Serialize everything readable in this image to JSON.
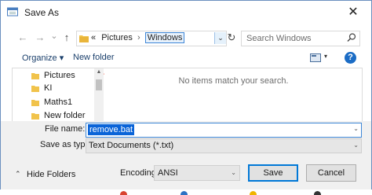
{
  "window": {
    "title": "Save As",
    "close_glyph": "✕"
  },
  "nav": {
    "back_glyph": "←",
    "forward_glyph": "→",
    "history_glyph": "⌄",
    "up_glyph": "↑",
    "address": {
      "overflow": "«",
      "crumbs": [
        "Pictures",
        "Windows"
      ],
      "sep": "›",
      "dropdown_glyph": "⌄"
    },
    "refresh_glyph": "↻",
    "search": {
      "placeholder": "Search Windows"
    }
  },
  "toolbar": {
    "organize_label": "Organize ▾",
    "new_folder_label": "New folder",
    "view_dd": "▾",
    "help_label": "?"
  },
  "navpane": {
    "items": [
      {
        "label": "Pictures",
        "pinned": true,
        "icon": "pictures-folder-icon"
      },
      {
        "label": "KI",
        "icon": "folder-icon"
      },
      {
        "label": "Maths1",
        "icon": "folder-icon"
      },
      {
        "label": "New folder",
        "icon": "folder-icon"
      }
    ],
    "pin_glyph": "📌"
  },
  "filepane": {
    "empty_message": "No items match your search."
  },
  "form": {
    "file_name_label": "File name:",
    "file_name_value": "remove.bat",
    "save_type_label": "Save as type:",
    "save_type_value": "Text Documents (*.txt)",
    "dropdown_glyph": "⌄"
  },
  "footer": {
    "hide_folders_chevron": "⌃",
    "hide_folders_label": "Hide Folders",
    "encoding_label": "Encoding:",
    "encoding_value": "ANSI",
    "save_label": "Save",
    "cancel_label": "Cancel"
  },
  "colors": {
    "accent": "#0078d7",
    "folder": "#f1c34b",
    "selection": "#0a64d8"
  }
}
